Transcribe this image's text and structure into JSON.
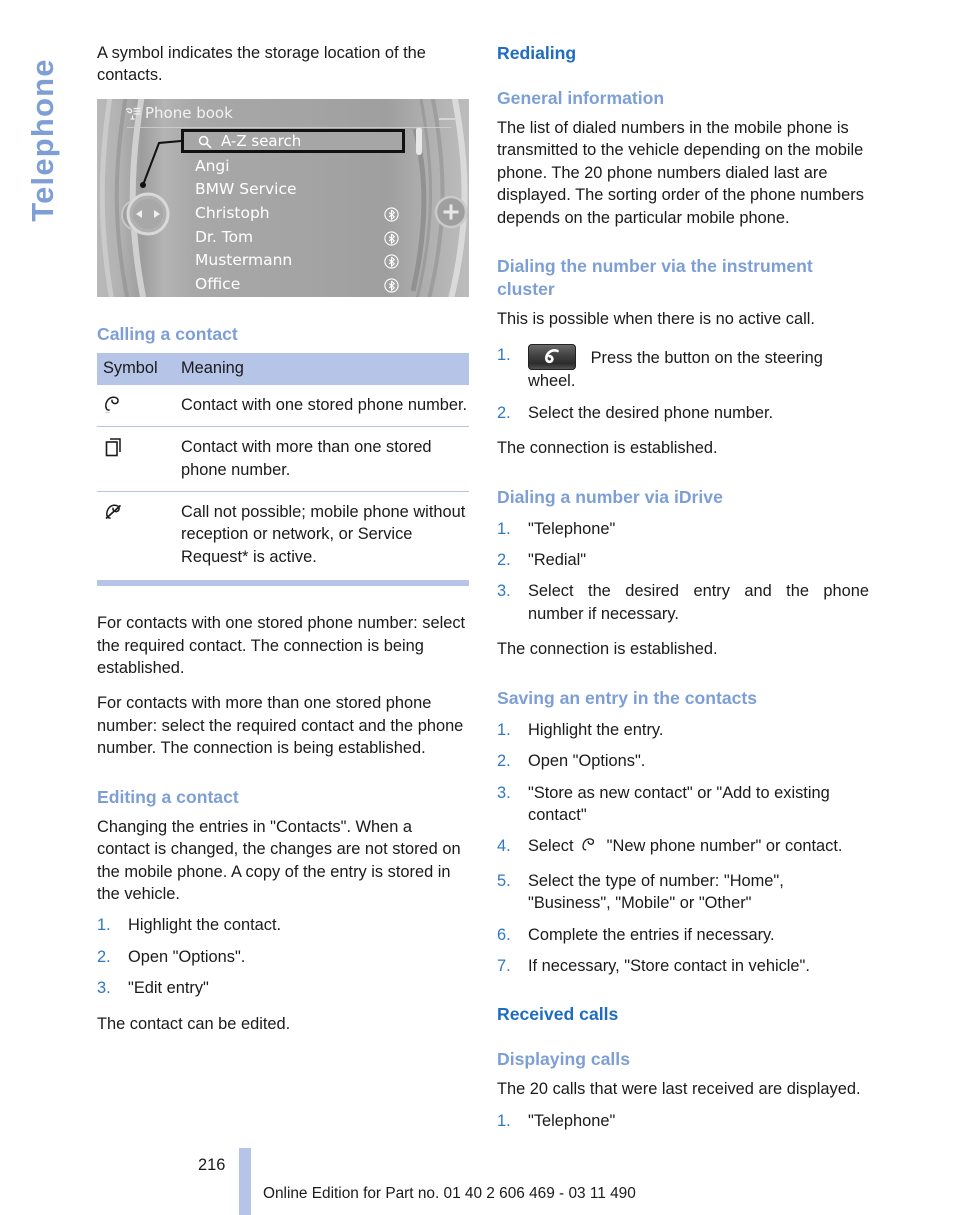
{
  "side_tab": {
    "label": "Telephone"
  },
  "left_column": {
    "intro": "A symbol indicates the storage location of the contacts.",
    "idrive": {
      "title": "Phone book",
      "title_icon": "phone-book-icon",
      "search_label": "A-Z search",
      "search_icon": "magnifier-icon",
      "plus_icon": "plus-button-icon",
      "nav_icon": "left-right-nav-icon",
      "entries": [
        {
          "name": "Angi",
          "bluetooth": false
        },
        {
          "name": "BMW Service",
          "bluetooth": false
        },
        {
          "name": "Christoph",
          "bluetooth": true
        },
        {
          "name": "Dr. Tom",
          "bluetooth": true
        },
        {
          "name": "Mustermann",
          "bluetooth": true
        },
        {
          "name": "Office",
          "bluetooth": true
        }
      ]
    },
    "calling_heading": "Calling a contact",
    "table": {
      "headers": [
        "Symbol",
        "Meaning"
      ],
      "rows": [
        {
          "symbol": "handset-icon",
          "meaning": "Contact with one stored phone number."
        },
        {
          "symbol": "stacked-cards-icon",
          "meaning": "Contact with more than one stored phone number."
        },
        {
          "symbol": "handset-crossed-out-icon",
          "meaning": "Call not possible; mobile phone without reception or network, or Service Request* is active."
        }
      ]
    },
    "para_one_number": "For contacts with one stored phone number: select the required contact. The connection is being established.",
    "para_more_numbers": "For contacts with more than one stored phone number: select the required contact and the phone number. The connection is being established.",
    "editing_heading": "Editing a contact",
    "editing_intro": "Changing the entries in \"Contacts\". When a contact is changed, the changes are not stored on the mobile phone. A copy of the entry is stored in the vehicle.",
    "editing_steps": [
      {
        "num": "1.",
        "text": "Highlight the contact."
      },
      {
        "num": "2.",
        "text": "Open \"Options\"."
      },
      {
        "num": "3.",
        "text": "\"Edit entry\""
      }
    ],
    "editing_outro": "The contact can be edited."
  },
  "right_column": {
    "redialing_heading": "Redialing",
    "general_info_heading": "General information",
    "general_info_text": "The list of dialed numbers in the mobile phone is transmitted to the vehicle depending on the mobile phone. The 20 phone numbers dialed last are displayed. The sorting order of the phone numbers depends on the particular mobile phone.",
    "instrument_cluster_heading": "Dialing the number via the instrument cluster",
    "instrument_cluster_intro": "This is possible when there is no active call.",
    "instrument_cluster_steps": [
      {
        "num": "1.",
        "icon": "steering-wheel-phone-button-icon",
        "text": "Press the button on the steering wheel."
      },
      {
        "num": "2.",
        "text": "Select the desired phone number."
      }
    ],
    "instrument_cluster_outro": "The connection is established.",
    "idrive_heading": "Dialing a number via iDrive",
    "idrive_steps": [
      {
        "num": "1.",
        "text": "\"Telephone\""
      },
      {
        "num": "2.",
        "text": "\"Redial\""
      },
      {
        "num": "3.",
        "text": "Select the desired entry and the phone number if necessary."
      }
    ],
    "idrive_outro": "The connection is established.",
    "saving_heading": "Saving an entry in the contacts",
    "saving_steps": [
      {
        "num": "1.",
        "text": "Highlight the entry."
      },
      {
        "num": "2.",
        "text": "Open \"Options\"."
      },
      {
        "num": "3.",
        "text": "\"Store as new contact\" or \"Add to existing contact\""
      },
      {
        "num": "4.",
        "text_before": "Select ",
        "icon": "handset-icon",
        "text_after": " \"New phone number\" or contact."
      },
      {
        "num": "5.",
        "text": "Select the type of number: \"Home\", \"Business\", \"Mobile\" or \"Other\""
      },
      {
        "num": "6.",
        "text": "Complete the entries if necessary."
      },
      {
        "num": "7.",
        "text": "If necessary, \"Store contact in vehicle\"."
      }
    ],
    "received_calls_heading": "Received calls",
    "displaying_calls_heading": "Displaying calls",
    "displaying_calls_text": "The 20 calls that were last received are displayed.",
    "displaying_calls_steps": [
      {
        "num": "1.",
        "text": "\"Telephone\""
      }
    ]
  },
  "footer": {
    "page_number": "216",
    "text": "Online Edition for Part no. 01 40 2 606 469 - 03 11 490"
  },
  "colors": {
    "section_heading": "#1f6cc0",
    "sub_heading": "#7d9fd6",
    "table_band": "#b6c4e8",
    "list_number": "#2f78c4"
  }
}
